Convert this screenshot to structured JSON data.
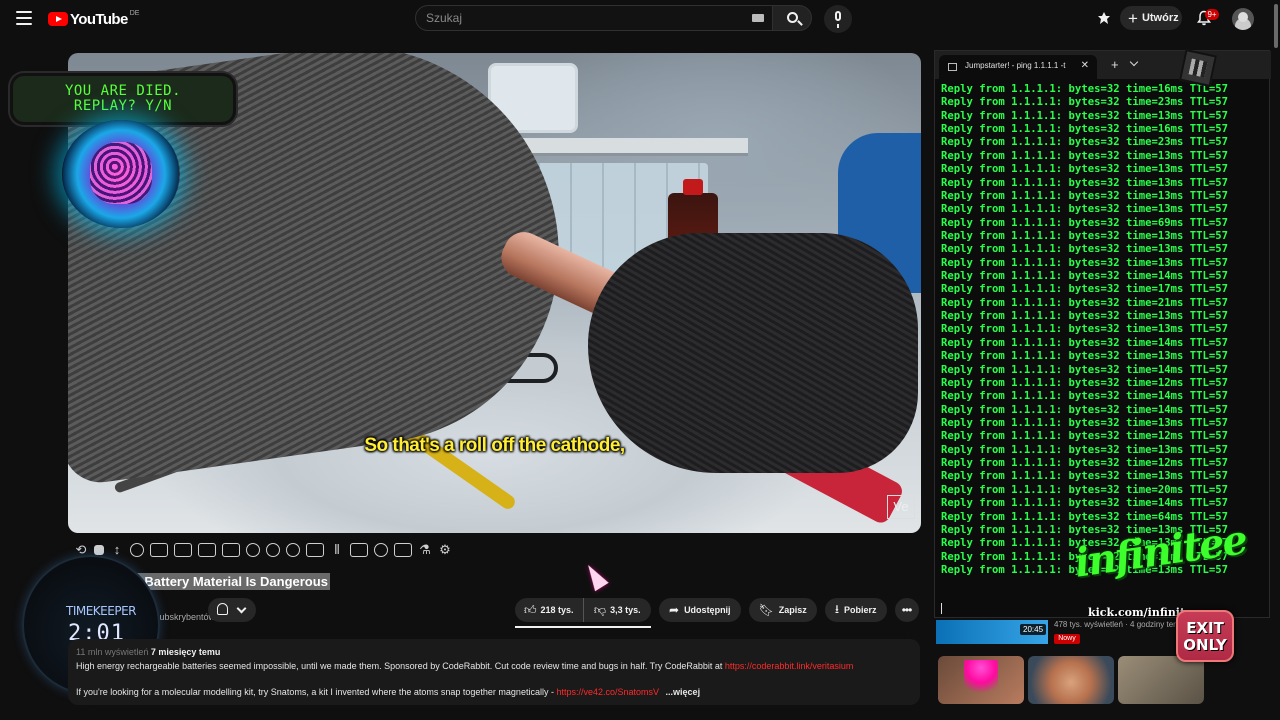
{
  "header": {
    "logo_text": "YouTube",
    "region": "DE",
    "search_placeholder": "Szukaj",
    "create_label": "Utwórz",
    "notifications_badge": "9+"
  },
  "video": {
    "caption": "So that's a roll off the cathode,",
    "watermark": "Ve"
  },
  "overlay": {
    "died_line1": "YOU ARE DIED.",
    "died_line2": "REPLAY? Y/N",
    "timekeeper_label": "TIMEKEEPER",
    "timekeeper_time": "2:01",
    "brand": "infinitee",
    "brand_url": "kick.com/infinitee",
    "exit_line1": "EXIT",
    "exit_line2": "ONLY"
  },
  "title": "The Perfect Battery Material Is Dangerous",
  "channel": {
    "subs_fragment": "mln subskrybentów"
  },
  "actions": {
    "likes": "218 tys.",
    "dislikes": "3,3 tys.",
    "share": "Udostępnij",
    "save": "Zapisz",
    "download": "Pobierz"
  },
  "description": {
    "views": "11 mln wyświetleń",
    "age": "7 miesięcy temu",
    "line1": "High energy rechargeable batteries seemed impossible, until we made them. Sponsored by CodeRabbit. Cut code review time and bugs in half. Try CodeRabbit at",
    "line1_link": "https://coderabbit.link/veritasium",
    "line2": "If you're looking for a molecular modelling kit, try Snatoms, a kit I invented where the atoms snap together magnetically -",
    "line2_link": "https://ve42.co/SnatomsV",
    "more": "...więcej"
  },
  "terminal": {
    "tab_title": "Jumpstarter! - ping  1.1.1.1 -t",
    "lines": [
      "Reply from 1.1.1.1: bytes=32 time=16ms TTL=57",
      "Reply from 1.1.1.1: bytes=32 time=23ms TTL=57",
      "Reply from 1.1.1.1: bytes=32 time=13ms TTL=57",
      "Reply from 1.1.1.1: bytes=32 time=16ms TTL=57",
      "Reply from 1.1.1.1: bytes=32 time=23ms TTL=57",
      "Reply from 1.1.1.1: bytes=32 time=13ms TTL=57",
      "Reply from 1.1.1.1: bytes=32 time=13ms TTL=57",
      "Reply from 1.1.1.1: bytes=32 time=13ms TTL=57",
      "Reply from 1.1.1.1: bytes=32 time=13ms TTL=57",
      "Reply from 1.1.1.1: bytes=32 time=13ms TTL=57",
      "Reply from 1.1.1.1: bytes=32 time=69ms TTL=57",
      "Reply from 1.1.1.1: bytes=32 time=13ms TTL=57",
      "Reply from 1.1.1.1: bytes=32 time=13ms TTL=57",
      "Reply from 1.1.1.1: bytes=32 time=13ms TTL=57",
      "Reply from 1.1.1.1: bytes=32 time=14ms TTL=57",
      "Reply from 1.1.1.1: bytes=32 time=17ms TTL=57",
      "Reply from 1.1.1.1: bytes=32 time=21ms TTL=57",
      "Reply from 1.1.1.1: bytes=32 time=13ms TTL=57",
      "Reply from 1.1.1.1: bytes=32 time=13ms TTL=57",
      "Reply from 1.1.1.1: bytes=32 time=14ms TTL=57",
      "Reply from 1.1.1.1: bytes=32 time=13ms TTL=57",
      "Reply from 1.1.1.1: bytes=32 time=14ms TTL=57",
      "Reply from 1.1.1.1: bytes=32 time=12ms TTL=57",
      "Reply from 1.1.1.1: bytes=32 time=14ms TTL=57",
      "Reply from 1.1.1.1: bytes=32 time=14ms TTL=57",
      "Reply from 1.1.1.1: bytes=32 time=13ms TTL=57",
      "Reply from 1.1.1.1: bytes=32 time=12ms TTL=57",
      "Reply from 1.1.1.1: bytes=32 time=13ms TTL=57",
      "Reply from 1.1.1.1: bytes=32 time=12ms TTL=57",
      "Reply from 1.1.1.1: bytes=32 time=13ms TTL=57",
      "Reply from 1.1.1.1: bytes=32 time=20ms TTL=57",
      "Reply from 1.1.1.1: bytes=32 time=14ms TTL=57",
      "Reply from 1.1.1.1: bytes=32 time=64ms TTL=57",
      "Reply from 1.1.1.1: bytes=32 time=13ms TTL=57",
      "Reply from 1.1.1.1: bytes=32 time=13ms TTL=57",
      "Reply from 1.1.1.1: bytes=32 time=13ms TTL=57",
      "Reply from 1.1.1.1: bytes=32 time=13ms TTL=57"
    ]
  },
  "sidebar": {
    "rec1_duration": "20:45",
    "rec1_meta": "478 tys. wyświetleń · 4 godziny temu",
    "rec1_badge": "Nowy"
  },
  "colors": {
    "accent_red": "#ff0000",
    "terminal_green": "#29ff4a",
    "caption_yellow": "#ffee33"
  }
}
